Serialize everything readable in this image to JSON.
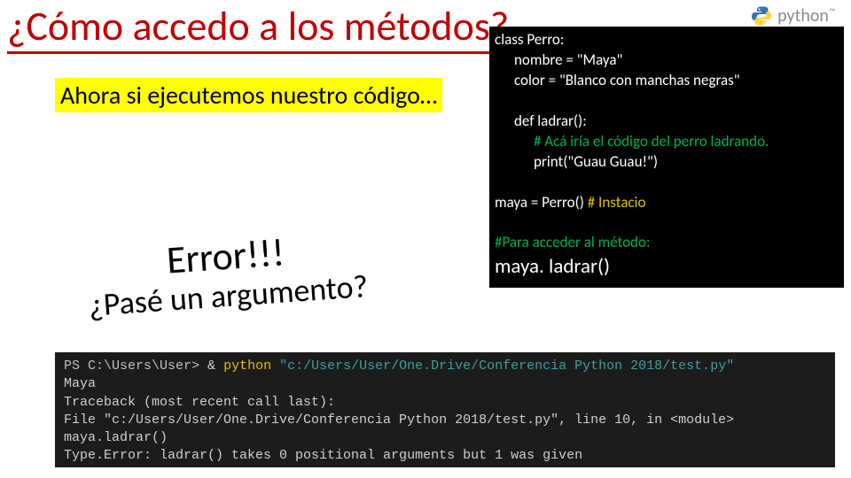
{
  "logo": {
    "text": "python",
    "tm": "™"
  },
  "title": "¿Cómo accedo a los métodos?",
  "highlight": "Ahora si ejecutemos nuestro código…",
  "error": {
    "line1": "Error!!!",
    "line2": "¿Pasé un argumento?"
  },
  "code": {
    "l1": "class Perro:",
    "l2": "nombre = \"Maya\"",
    "l3": "color = \"Blanco con manchas negras\"",
    "l4": "def ladrar():",
    "l5": "# Acá iría el código del perro ladrando.",
    "l6": "print(\"Guau Guau!\")",
    "l7a": "maya = Perro() ",
    "l7b": "# Instacio",
    "l8": "#Para acceder al método:",
    "l9": "maya. ladrar()"
  },
  "terminal": {
    "prompt_path": "PS C:\\Users\\User>",
    "amp": "&",
    "cmd": "python",
    "arg": "\"c:/Users/User/One.Drive/Conferencia Python 2018/test.py\"",
    "o1": "Maya",
    "o2": "Traceback (most recent call last):",
    "o3": "  File \"c:/Users/User/One.Drive/Conferencia Python 2018/test.py\", line 10, in <module>",
    "o4": "    maya.ladrar()",
    "o5": "Type.Error: ladrar() takes 0 positional arguments but 1 was given"
  }
}
